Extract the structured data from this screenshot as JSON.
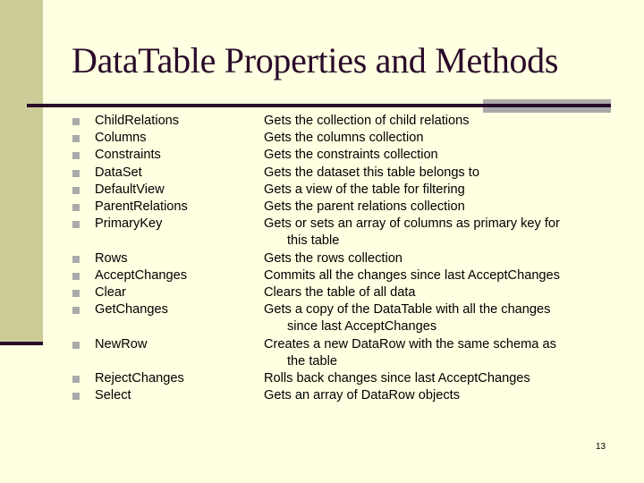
{
  "slide": {
    "title": "DataTable Properties and Methods",
    "page_number": "13",
    "colors": {
      "background": "#ffffe1",
      "sidebar": "#cccc99",
      "title_text": "#2a0a2a",
      "rule": "#2a0a2a",
      "accent_bar": "#aaaaaa",
      "bullet": "#aaaaaa"
    },
    "bullet_icon": "square-bullet-icon"
  },
  "groups": [
    {
      "items": [
        {
          "name": "ChildRelations",
          "desc": "Gets the collection of child relations",
          "desc_cont": ""
        },
        {
          "name": "Columns",
          "desc": "Gets the columns collection",
          "desc_cont": ""
        },
        {
          "name": "Constraints",
          "desc": "Gets the constraints collection",
          "desc_cont": ""
        },
        {
          "name": "DataSet",
          "desc": "Gets the dataset this table belongs to",
          "desc_cont": ""
        },
        {
          "name": "DefaultView",
          "desc": "Gets a view of the table for filtering",
          "desc_cont": ""
        },
        {
          "name": "ParentRelations",
          "desc": "Gets the parent relations collection",
          "desc_cont": ""
        },
        {
          "name": "PrimaryKey",
          "desc": "Gets or sets an array of columns as primary key for",
          "desc_cont": "this table"
        }
      ]
    },
    {
      "items": [
        {
          "name": "Rows",
          "desc": "Gets the rows collection",
          "desc_cont": ""
        },
        {
          "name": "AcceptChanges",
          "desc": "Commits all the changes since last AcceptChanges",
          "desc_cont": ""
        },
        {
          "name": "Clear",
          "desc": "Clears the table of all data",
          "desc_cont": ""
        },
        {
          "name": "GetChanges",
          "desc": "Gets a copy of the DataTable with all the changes",
          "desc_cont": "since last AcceptChanges"
        },
        {
          "name": "NewRow",
          "desc": "Creates a new DataRow with the same schema as",
          "desc_cont": "the table"
        },
        {
          "name": "RejectChanges",
          "desc": "Rolls back changes since last AcceptChanges",
          "desc_cont": ""
        },
        {
          "name": "Select",
          "desc": "Gets an array of DataRow objects",
          "desc_cont": ""
        }
      ]
    }
  ]
}
